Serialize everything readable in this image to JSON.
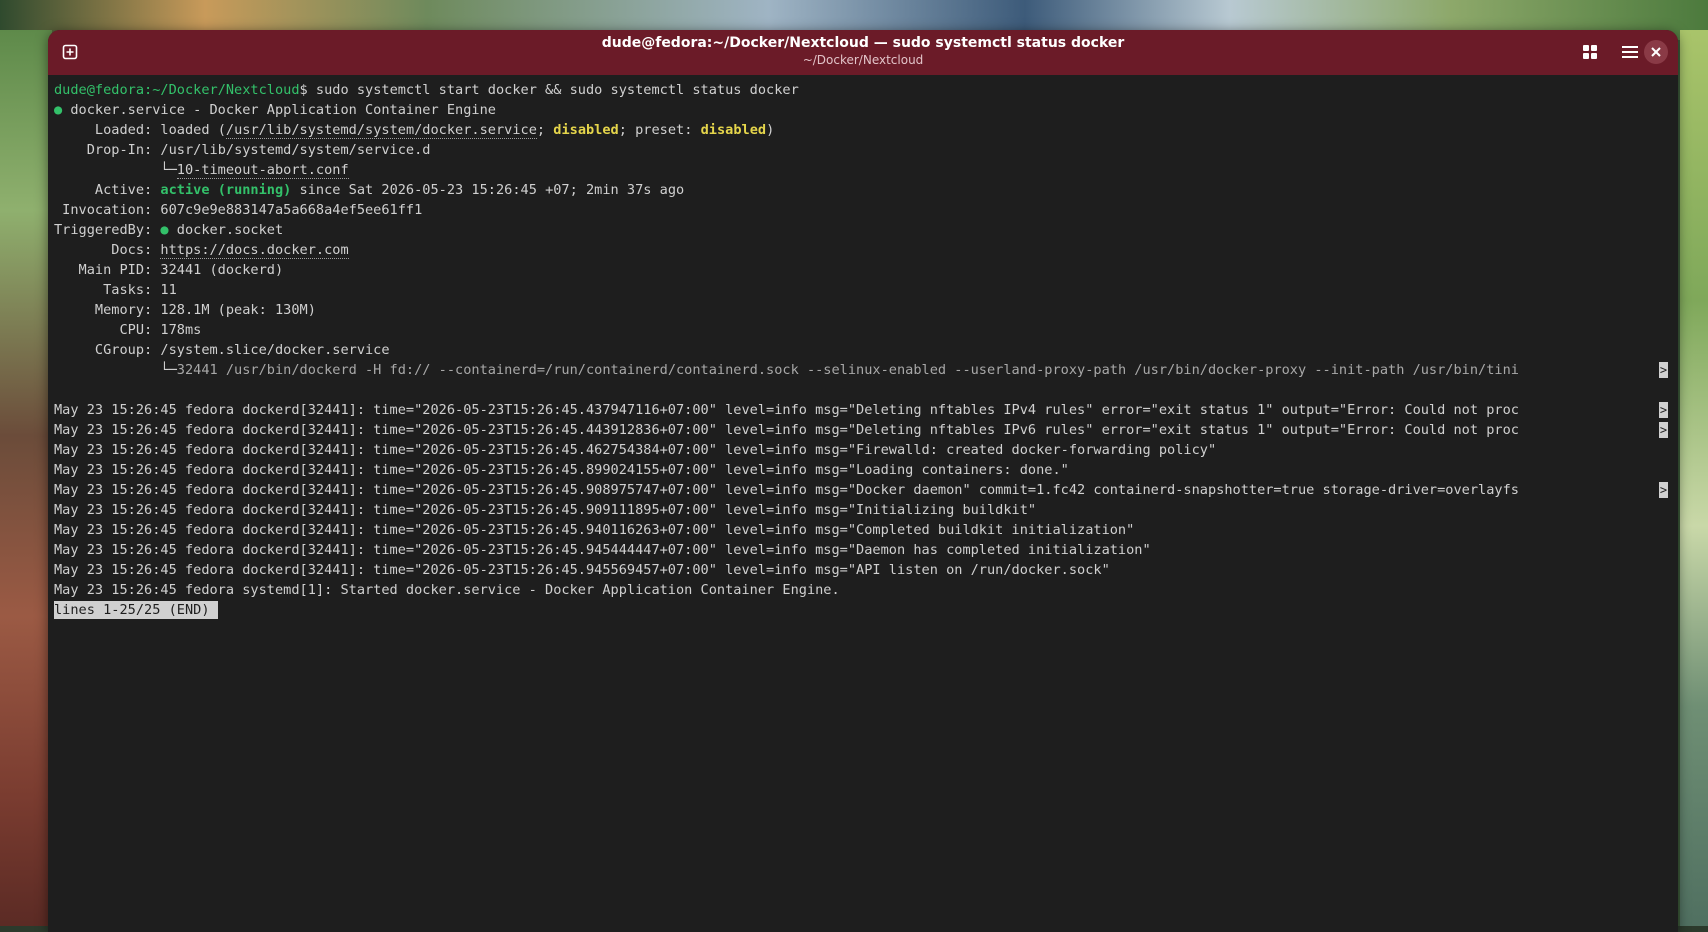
{
  "window": {
    "title": "dude@fedora:~/Docker/Nextcloud — sudo systemctl status docker",
    "subtitle": "~/Docker/Nextcloud"
  },
  "colors": {
    "headerbar": "#6b1b28",
    "terminal_bg": "#1e1e1e",
    "green": "#33c16a",
    "yellow": "#e5d54b"
  },
  "icons": {
    "new_tab": "new-tab-icon",
    "view_tabs": "grid-icon",
    "menu": "hamburger-menu-icon",
    "close": "close-icon"
  },
  "terminal": {
    "prompt_user": "dude@fedora",
    "prompt_path": ":~/Docker/Nextcloud",
    "prompt_symbol": "$ ",
    "command": "sudo systemctl start docker && sudo systemctl status docker",
    "bullet": "●",
    "service_line": " docker.service - Docker Application Container Engine",
    "loaded_label": "     Loaded: ",
    "loaded_prefix": "loaded (",
    "loaded_path": "/usr/lib/systemd/system/docker.service",
    "loaded_sep": "; ",
    "loaded_state": "disabled",
    "loaded_preset": "; preset: ",
    "loaded_preset_state": "disabled",
    "loaded_suffix": ")",
    "dropin_label": "    Drop-In: ",
    "dropin_path": "/usr/lib/systemd/system/service.d",
    "dropin_tree": "             └─",
    "dropin_file": "10-timeout-abort.conf",
    "active_label": "     Active: ",
    "active_state": "active (running)",
    "active_since": " since Sat 2026-05-23 15:26:45 +07; 2min 37s ago",
    "invocation": " Invocation: 607c9e9e883147a5a668a4ef5ee61ff1",
    "triggered_label": "TriggeredBy: ",
    "triggered_value": " docker.socket",
    "docs_label": "       Docs: ",
    "docs_url": "https://docs.docker.com",
    "mainpid": "   Main PID: 32441 (dockerd)",
    "tasks": "      Tasks: 11",
    "memory": "     Memory: 128.1M (peak: 130M)",
    "cpu": "        CPU: 178ms",
    "cgroup": "     CGroup: /system.slice/docker.service",
    "cgroup_tree": "             └─",
    "cgroup_proc": "32441 /usr/bin/dockerd -H fd:// --containerd=/run/containerd/containerd.sock --selinux-enabled --userland-proxy-path /usr/bin/docker-proxy --init-path /usr/bin/tini",
    "trunc_marker": ">",
    "log": [
      "May 23 15:26:45 fedora dockerd[32441]: time=\"2026-05-23T15:26:45.437947116+07:00\" level=info msg=\"Deleting nftables IPv4 rules\" error=\"exit status 1\" output=\"Error: Could not proc",
      "May 23 15:26:45 fedora dockerd[32441]: time=\"2026-05-23T15:26:45.443912836+07:00\" level=info msg=\"Deleting nftables IPv6 rules\" error=\"exit status 1\" output=\"Error: Could not proc",
      "May 23 15:26:45 fedora dockerd[32441]: time=\"2026-05-23T15:26:45.462754384+07:00\" level=info msg=\"Firewalld: created docker-forwarding policy\"",
      "May 23 15:26:45 fedora dockerd[32441]: time=\"2026-05-23T15:26:45.899024155+07:00\" level=info msg=\"Loading containers: done.\"",
      "May 23 15:26:45 fedora dockerd[32441]: time=\"2026-05-23T15:26:45.908975747+07:00\" level=info msg=\"Docker daemon\" commit=1.fc42 containerd-snapshotter=true storage-driver=overlayfs",
      "May 23 15:26:45 fedora dockerd[32441]: time=\"2026-05-23T15:26:45.909111895+07:00\" level=info msg=\"Initializing buildkit\"",
      "May 23 15:26:45 fedora dockerd[32441]: time=\"2026-05-23T15:26:45.940116263+07:00\" level=info msg=\"Completed buildkit initialization\"",
      "May 23 15:26:45 fedora dockerd[32441]: time=\"2026-05-23T15:26:45.945444447+07:00\" level=info msg=\"Daemon has completed initialization\"",
      "May 23 15:26:45 fedora dockerd[32441]: time=\"2026-05-23T15:26:45.945569457+07:00\" level=info msg=\"API listen on /run/docker.sock\"",
      "May 23 15:26:45 fedora systemd[1]: Started docker.service - Docker Application Container Engine."
    ],
    "pager_status": "lines 1-25/25 (END)"
  }
}
